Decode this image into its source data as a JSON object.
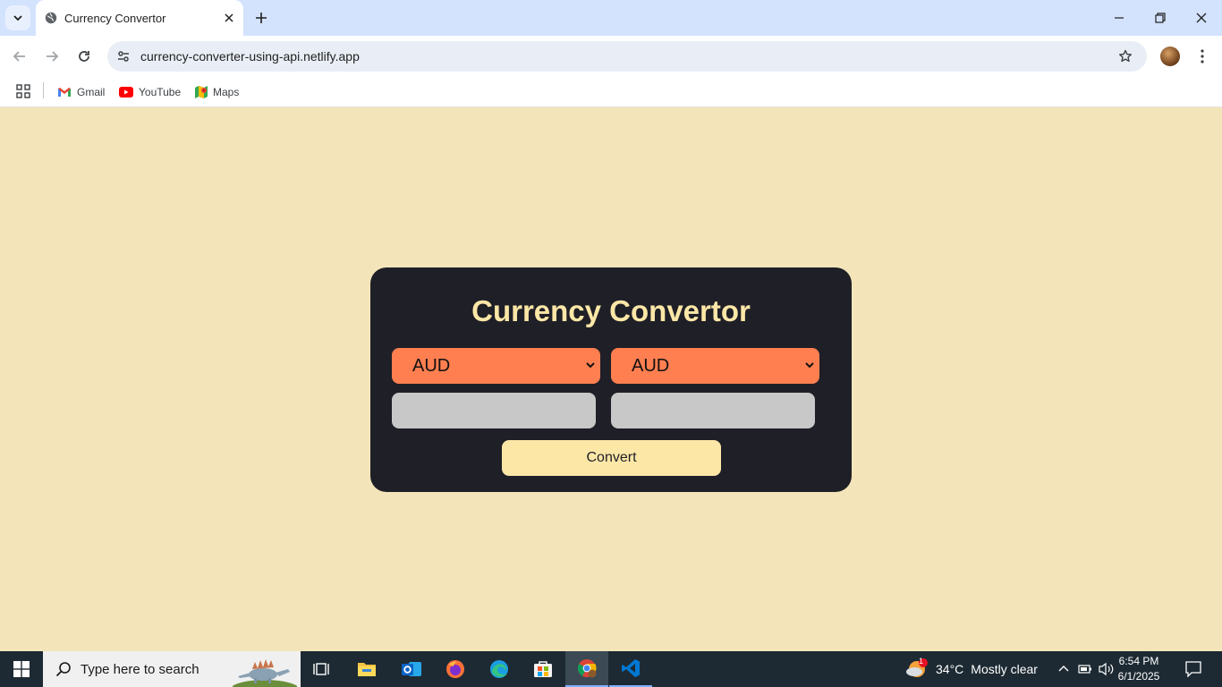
{
  "browser": {
    "tab_title": "Currency Convertor",
    "url": "currency-converter-using-api.netlify.app",
    "bookmarks": [
      {
        "label": "Gmail",
        "icon": "gmail-icon"
      },
      {
        "label": "YouTube",
        "icon": "youtube-icon"
      },
      {
        "label": "Maps",
        "icon": "maps-icon"
      }
    ]
  },
  "page": {
    "title": "Currency Convertor",
    "from_currency": "AUD",
    "to_currency": "AUD",
    "from_amount": "",
    "to_amount": "",
    "convert_label": "Convert",
    "colors": {
      "background": "#f3e5b9",
      "card": "#1f1f27",
      "select": "#ff7f50",
      "title": "#fde7a7",
      "input": "#c8c8c8",
      "button": "#fde7a7"
    }
  },
  "taskbar": {
    "search_placeholder": "Type here to search",
    "weather_temp": "34°C",
    "weather_desc": "Mostly clear",
    "weather_badge": "1",
    "time": "6:54 PM",
    "date": "6/1/2025"
  }
}
